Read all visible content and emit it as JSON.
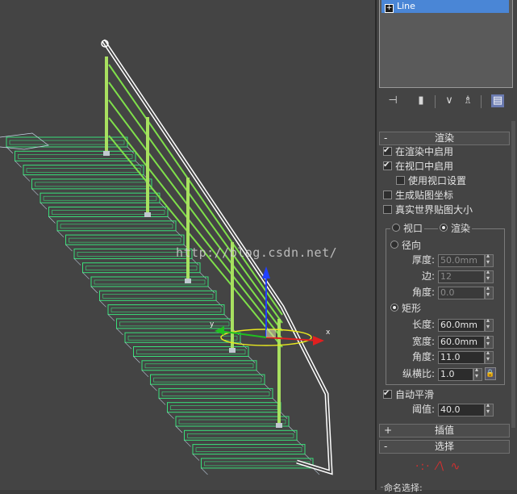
{
  "viewport": {
    "watermark": "http://blog.csdn.net/",
    "axis_x": "x",
    "axis_y": "y"
  },
  "modifier_stack": {
    "item": "Line"
  },
  "toolbar": {
    "icons": [
      "pin-stack-icon",
      "show-end-result-icon",
      "make-unique-icon",
      "remove-modifier-icon",
      "configure-modifier-sets-icon"
    ]
  },
  "rendering": {
    "title": "渲染",
    "sign": "-",
    "enable_in_renderer": {
      "label": "在渲染中启用",
      "checked": true
    },
    "enable_in_viewport": {
      "label": "在视口中启用",
      "checked": true
    },
    "use_viewport_settings": {
      "label": "使用视口设置",
      "checked": false
    },
    "generate_mapping_coords": {
      "label": "生成贴图坐标",
      "checked": false
    },
    "real_world_map_size": {
      "label": "真实世界贴图大小",
      "checked": false
    },
    "mode_viewport": "视口",
    "mode_render": "渲染",
    "radial": {
      "label": "径向",
      "thickness_label": "厚度:",
      "thickness": "50.0mm",
      "sides_label": "边:",
      "sides": "12",
      "angle_label": "角度:",
      "angle": "0.0"
    },
    "rectangular": {
      "label": "矩形",
      "length_label": "长度:",
      "length": "60.0mm",
      "width_label": "宽度:",
      "width": "60.0mm",
      "angle_label": "角度:",
      "angle": "11.0",
      "aspect_label": "纵横比:",
      "aspect": "1.0"
    },
    "auto_smooth": {
      "label": "自动平滑",
      "checked": true
    },
    "threshold_label": "阈值:",
    "threshold": "40.0"
  },
  "interpolation": {
    "title": "插值",
    "sign": "+"
  },
  "selection": {
    "title": "选择",
    "sign": "-",
    "named_selection": "命名选择:"
  }
}
